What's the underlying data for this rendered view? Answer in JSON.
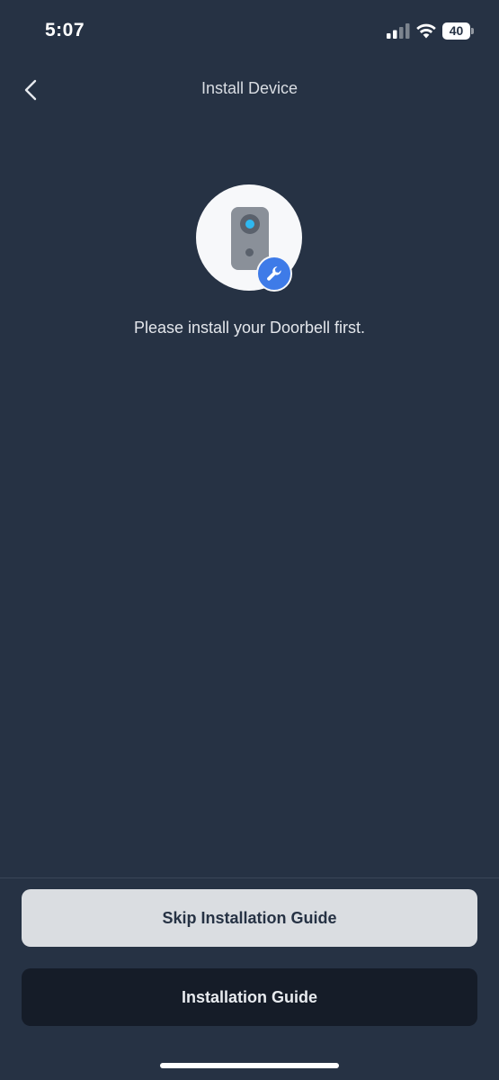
{
  "status_bar": {
    "time": "5:07",
    "battery_level": "40",
    "icons": [
      "signal-icon",
      "wifi-icon",
      "battery-icon"
    ]
  },
  "header": {
    "title": "Install Device",
    "back_icon": "chevron-left-icon"
  },
  "main": {
    "illustration_icon": "doorbell-icon",
    "badge_icon": "wrench-icon",
    "message": "Please install your Doorbell first."
  },
  "actions": {
    "skip_label": "Skip Installation Guide",
    "guide_label": "Installation Guide"
  },
  "colors": {
    "background": "#263244",
    "accent_blue": "#3e7be8",
    "lens_blue": "#2fb8f0",
    "skip_button": "#dadde1",
    "guide_button": "#151c28"
  }
}
